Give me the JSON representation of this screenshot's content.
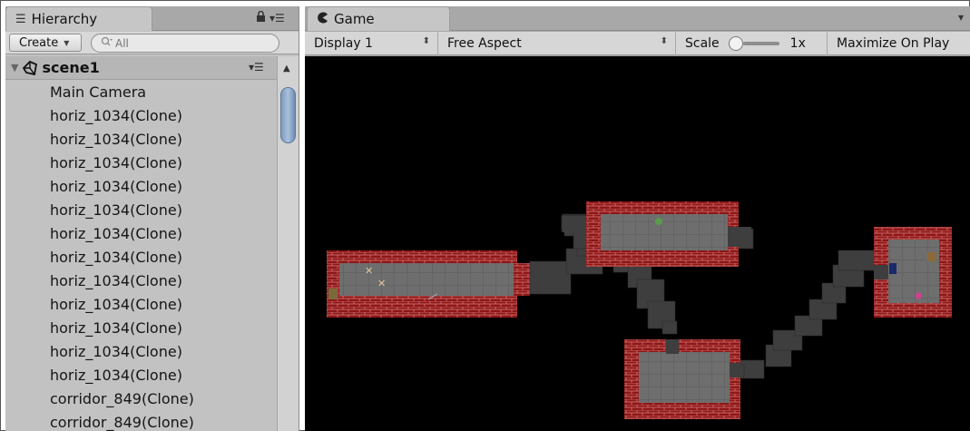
{
  "hierarchy": {
    "tab_label": "Hierarchy",
    "tab_icon": "list-icon",
    "create_label": "Create",
    "search_placeholder": "All",
    "scene_name": "scene1",
    "items": [
      "Main Camera",
      "horiz_1034(Clone)",
      "horiz_1034(Clone)",
      "horiz_1034(Clone)",
      "horiz_1034(Clone)",
      "horiz_1034(Clone)",
      "horiz_1034(Clone)",
      "horiz_1034(Clone)",
      "horiz_1034(Clone)",
      "horiz_1034(Clone)",
      "horiz_1034(Clone)",
      "horiz_1034(Clone)",
      "horiz_1034(Clone)",
      "corridor_849(Clone)",
      "corridor_849(Clone)"
    ]
  },
  "game": {
    "tab_label": "Game",
    "tab_icon": "pacman-icon",
    "display": "Display 1",
    "aspect": "Free Aspect",
    "scale_label": "Scale",
    "scale_value": "1x",
    "maximize_label": "Maximize On Play"
  },
  "colors": {
    "panel_bg": "#c2c2c2",
    "selection_thumb": "#8fa9c9",
    "game_bg": "#000000",
    "wall_red": "#9c1b1b",
    "floor_gray": "#6f6f6f",
    "corridor_gray": "#3f3f3f"
  }
}
